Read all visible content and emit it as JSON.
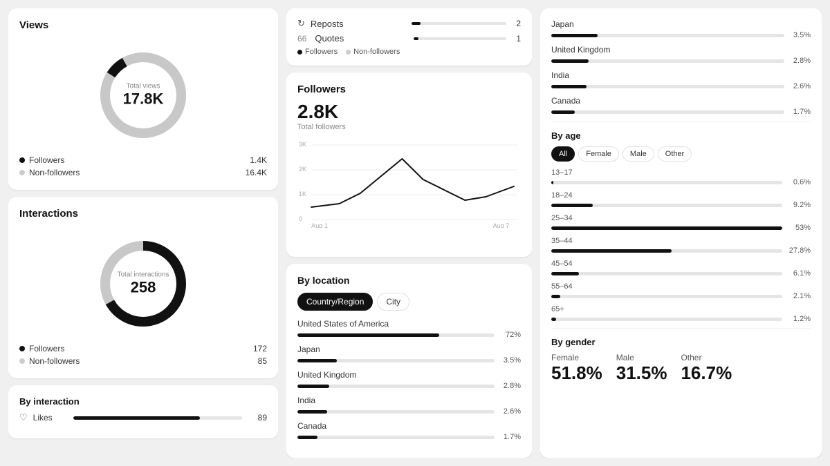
{
  "views": {
    "title": "Views",
    "total_label": "Total views",
    "total_value": "17.8K",
    "followers_count": "1.4K",
    "nonfollowers_count": "16.4K",
    "donut_followers_pct": 7.9,
    "donut_nonfollowers_pct": 92.1
  },
  "interactions": {
    "title": "Interactions",
    "total_label": "Total interactions",
    "total_value": "258",
    "followers_count": "172",
    "nonfollowers_count": "85",
    "donut_followers_pct": 67,
    "donut_nonfollowers_pct": 33
  },
  "by_interaction": {
    "title": "By interaction",
    "items": [
      {
        "icon": "♡",
        "label": "Likes",
        "value": 89,
        "max": 100,
        "dark_pct": 75,
        "light_pct": 25
      }
    ]
  },
  "reposts": {
    "reposts_label": "Reposts",
    "reposts_count": "2",
    "quotes_num": "66",
    "quotes_label": "Quotes",
    "quotes_count": "1",
    "followers_label": "Followers",
    "nonfollowers_label": "Non-followers"
  },
  "followers": {
    "title": "Followers",
    "total_value": "2.8K",
    "total_label": "Total followers",
    "chart_x_start": "Aug 1",
    "chart_x_end": "Aug 7",
    "chart_y_labels": [
      "3K",
      "2K",
      "1K",
      "0"
    ]
  },
  "by_location": {
    "title": "By location",
    "tab_region": "Country/Region",
    "tab_city": "City",
    "countries": [
      {
        "name": "United States of America",
        "pct": 72,
        "pct_label": "72%"
      },
      {
        "name": "Japan",
        "pct": 3.5,
        "pct_label": "3.5%"
      },
      {
        "name": "United Kingdom",
        "pct": 2.8,
        "pct_label": "2.8%"
      },
      {
        "name": "India",
        "pct": 2.6,
        "pct_label": "2.6%"
      },
      {
        "name": "Canada",
        "pct": 1.7,
        "pct_label": "1.7%"
      }
    ]
  },
  "audience": {
    "countries": [
      {
        "name": "Japan",
        "pct": 3.5,
        "pct_label": "3.5%",
        "bar_pct": 20
      },
      {
        "name": "United Kingdom",
        "pct": 2.8,
        "pct_label": "2.8%",
        "bar_pct": 16
      },
      {
        "name": "India",
        "pct": 2.6,
        "pct_label": "2.6%",
        "bar_pct": 15
      },
      {
        "name": "Canada",
        "pct": 1.7,
        "pct_label": "1.7%",
        "bar_pct": 10
      }
    ],
    "by_age_title": "By age",
    "age_filters": [
      "All",
      "Female",
      "Male",
      "Other"
    ],
    "age_active": "All",
    "age_groups": [
      {
        "range": "13–17",
        "pct_label": "0.6%",
        "bar_pct": 1
      },
      {
        "range": "18–24",
        "pct_label": "9.2%",
        "bar_pct": 18
      },
      {
        "range": "25–34",
        "pct_label": "53%",
        "bar_pct": 100
      },
      {
        "range": "35–44",
        "pct_label": "27.8%",
        "bar_pct": 52
      },
      {
        "range": "45–54",
        "pct_label": "6.1%",
        "bar_pct": 12
      },
      {
        "range": "55–64",
        "pct_label": "2.1%",
        "bar_pct": 4
      },
      {
        "range": "65+",
        "pct_label": "1.2%",
        "bar_pct": 2
      }
    ],
    "by_gender_title": "By gender",
    "gender": [
      {
        "label": "Female",
        "value": "51.8%"
      },
      {
        "label": "Male",
        "value": "31.5%"
      },
      {
        "label": "Other",
        "value": "16.7%"
      }
    ]
  },
  "legend": {
    "followers": "Followers",
    "nonfollowers": "Non-followers"
  }
}
